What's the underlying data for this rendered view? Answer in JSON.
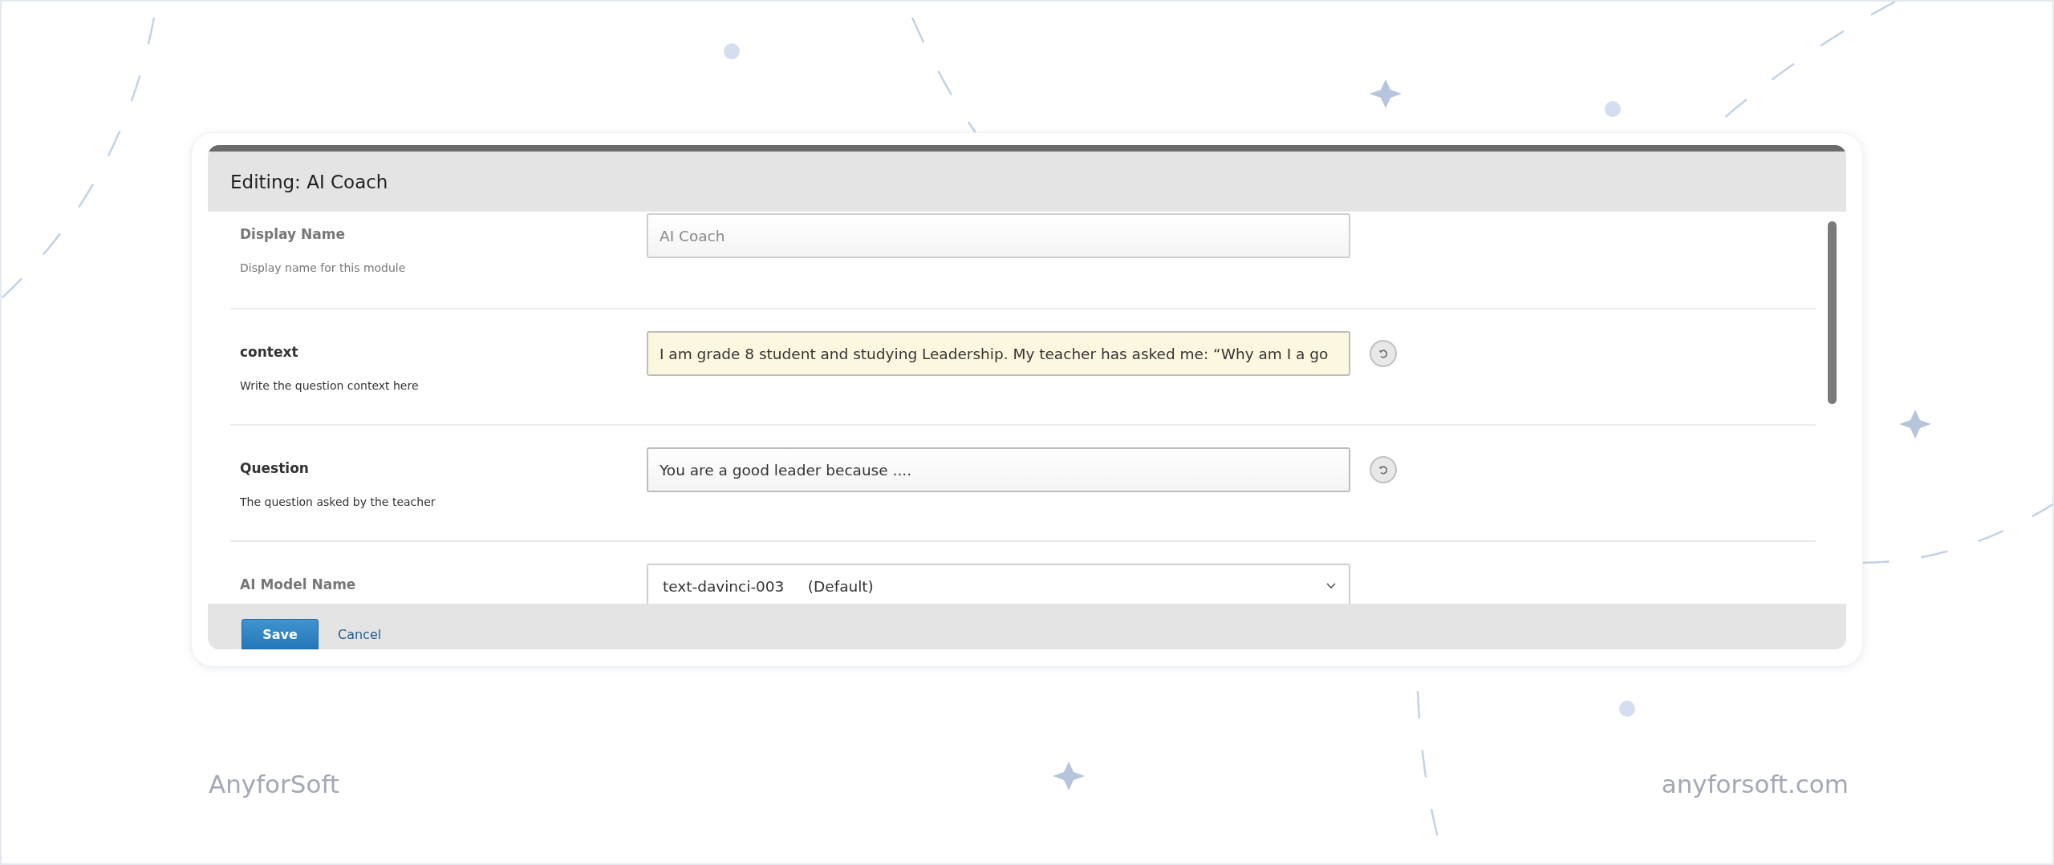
{
  "dialog": {
    "title": "Editing: AI Coach",
    "fields": [
      {
        "kind": "text",
        "label": "Display Name",
        "description": "Display name for this module",
        "value": "AI Coach",
        "is_set": false,
        "highlighted": false
      },
      {
        "kind": "text",
        "label": "context",
        "description": "Write the question context here",
        "value": "I am grade 8 student and studying Leadership. My teacher has asked me: “Why am I a go",
        "is_set": true,
        "highlighted": true
      },
      {
        "kind": "text",
        "label": "Question",
        "description": "The question asked by the teacher",
        "value": "You are a good leader because ....",
        "is_set": true,
        "highlighted": false
      },
      {
        "kind": "select",
        "label": "AI Model Name",
        "value": "text-davinci-003     (Default)",
        "is_set": false
      }
    ],
    "buttons": [
      {
        "kind": "primary",
        "label": "Save"
      },
      {
        "kind": "link",
        "label": "Cancel"
      }
    ]
  },
  "footer": {
    "brand": "AnyforSoft",
    "site": "anyforsoft.com"
  }
}
